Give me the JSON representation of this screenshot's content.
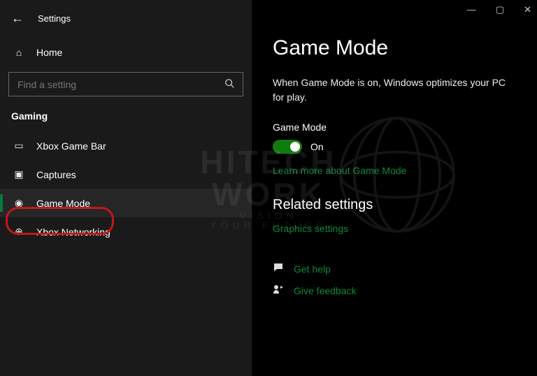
{
  "titlebar": {
    "app": "Settings"
  },
  "sidebar": {
    "home_label": "Home",
    "search_placeholder": "Find a setting",
    "category": "Gaming",
    "items": [
      {
        "label": "Xbox Game Bar"
      },
      {
        "label": "Captures"
      },
      {
        "label": "Game Mode"
      },
      {
        "label": "Xbox Networking"
      }
    ]
  },
  "main": {
    "heading": "Game Mode",
    "description": "When Game Mode is on, Windows optimizes your PC for play.",
    "toggle_label": "Game Mode",
    "toggle_state": "On",
    "learn_more": "Learn more about Game Mode",
    "related_heading": "Related settings",
    "graphics_link": "Graphics settings",
    "get_help": "Get help",
    "give_feedback": "Give feedback"
  },
  "watermark": {
    "line1": "HITECH",
    "line2": "WORK",
    "tag1": "VISION",
    "tag2": "YOUR FUTURE"
  }
}
